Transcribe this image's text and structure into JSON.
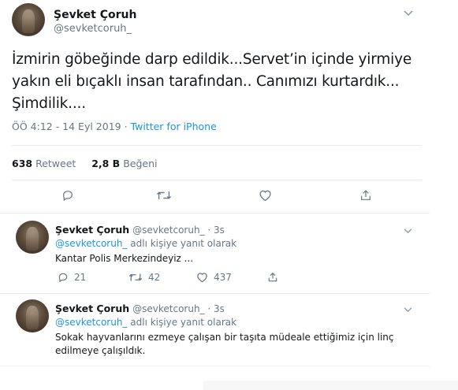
{
  "main_tweet": {
    "display_name": "Şevket Çoruh",
    "handle": "@sevketcoruh_",
    "text_lines": [
      "İzmirin göbeğinde darp edildik...Servet’in içinde yirmiye",
      "yakın eli bıçaklı insan tarafından.. Canımızı kurtardık...",
      "Şimdilik...."
    ],
    "timestamp": "ÖÖ 4:12 - 14 Eyl 2019 ·",
    "source": "Twitter for iPhone",
    "retweet_count": "638",
    "retweet_label": "Retweet",
    "like_count": "2,8 B",
    "like_label": "Beğeni"
  },
  "replies": [
    {
      "display_name": "Şevket Çoruh",
      "handle_time": "@sevketcoruh_ · 3s",
      "replying_handle": "@sevketcoruh_",
      "replying_suffix": "adlı kişiye yanıt olarak",
      "text": "Kantar Polis Merkezindeyiz ...",
      "reply_count": "21",
      "retweet_count": "42",
      "like_count": "437"
    },
    {
      "display_name": "Şevket Çoruh",
      "handle_time": "@sevketcoruh_ · 3s",
      "replying_handle": "@sevketcoruh_",
      "replying_suffix": "adlı kişiye yanıt olarak",
      "text_lines": [
        "Sokak hayvanlarını ezmeye çalışan bir taşıta müdeale ettiğimiz için  linç",
        "edilmeye çalışıldık."
      ]
    }
  ],
  "icons": {
    "caret": "chevron-down-icon",
    "reply": "reply-icon",
    "retweet": "retweet-icon",
    "like": "heart-icon",
    "share": "share-icon"
  },
  "colors": {
    "text": "#14171a",
    "muted": "#657786",
    "link": "#1b95e0",
    "divider": "#e6ecf0"
  }
}
